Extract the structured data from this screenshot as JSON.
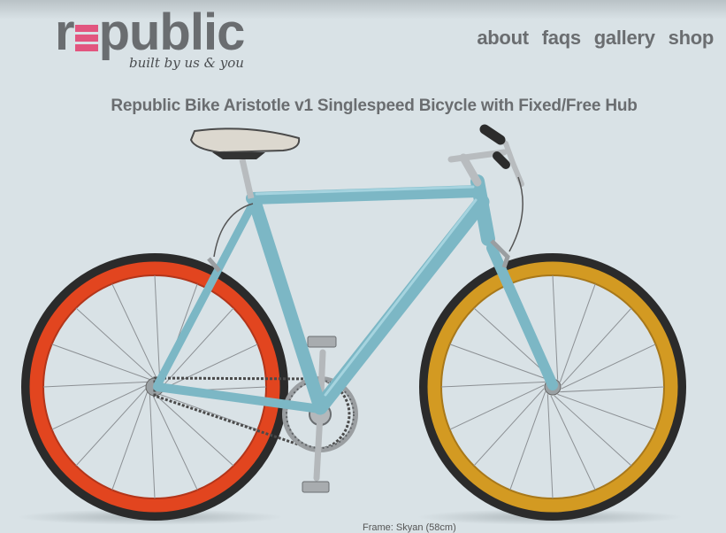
{
  "header": {
    "logo_text_left": "r",
    "logo_text_right": "public",
    "tagline": "built by us & you"
  },
  "nav": {
    "items": [
      {
        "label": "about"
      },
      {
        "label": "faqs"
      },
      {
        "label": "gallery"
      },
      {
        "label": "shop"
      }
    ]
  },
  "product": {
    "title": "Republic Bike Aristotle v1 Singlespeed Bicycle with Fixed/Free Hub",
    "caption": "Frame: Skyan (58cm)"
  },
  "colors": {
    "frame": "#7cb7c5",
    "rear_rim": "#e2451f",
    "front_rim": "#d39a22",
    "tire": "#2b2b2b",
    "logo_accent": "#e2557f",
    "text": "#6a6d70",
    "background": "#d9e2e6"
  }
}
